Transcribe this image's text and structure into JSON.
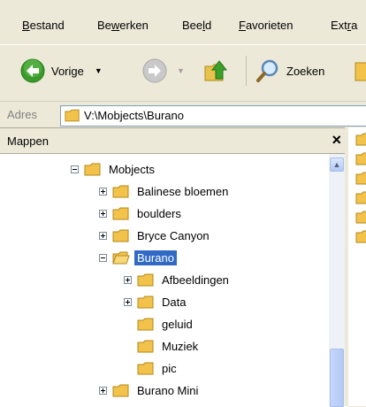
{
  "menu": {
    "items": [
      {
        "pre": "",
        "acc": "B",
        "post": "estand"
      },
      {
        "pre": "Be",
        "acc": "w",
        "post": "erken"
      },
      {
        "pre": "Bee",
        "acc": "l",
        "post": "d"
      },
      {
        "pre": "",
        "acc": "F",
        "post": "avorieten"
      },
      {
        "pre": "Ext",
        "acc": "r",
        "post": "a"
      }
    ]
  },
  "toolbar": {
    "back_label": "Vorige",
    "search_label": "Zoeken"
  },
  "address": {
    "label": "Adres",
    "value": "V:\\Mobjects\\Burano"
  },
  "folders_pane": {
    "title": "Mappen",
    "close_glyph": "×"
  },
  "tree": [
    {
      "label": "Mobjects",
      "expander": "minus",
      "selected": false
    },
    {
      "label": "Balinese bloemen",
      "expander": "plus",
      "selected": false
    },
    {
      "label": "boulders",
      "expander": "plus",
      "selected": false
    },
    {
      "label": "Bryce Canyon",
      "expander": "plus",
      "selected": false
    },
    {
      "label": "Burano",
      "expander": "minus",
      "selected": true,
      "open": true
    },
    {
      "label": "Afbeeldingen",
      "expander": "plus",
      "selected": false
    },
    {
      "label": "Data",
      "expander": "plus",
      "selected": false
    },
    {
      "label": "geluid",
      "expander": "none",
      "selected": false
    },
    {
      "label": "Muziek",
      "expander": "none",
      "selected": false
    },
    {
      "label": "pic",
      "expander": "none",
      "selected": false
    },
    {
      "label": "Burano Mini",
      "expander": "plus",
      "selected": false
    }
  ],
  "icons": {
    "back": "back-arrow-icon",
    "forward": "forward-arrow-icon",
    "up": "folder-up-icon",
    "search": "search-icon",
    "folder": "folder-icon"
  },
  "colors": {
    "selection": "#316ac5",
    "chrome": "#ece9d8",
    "back_green": "#3a9a2a"
  }
}
